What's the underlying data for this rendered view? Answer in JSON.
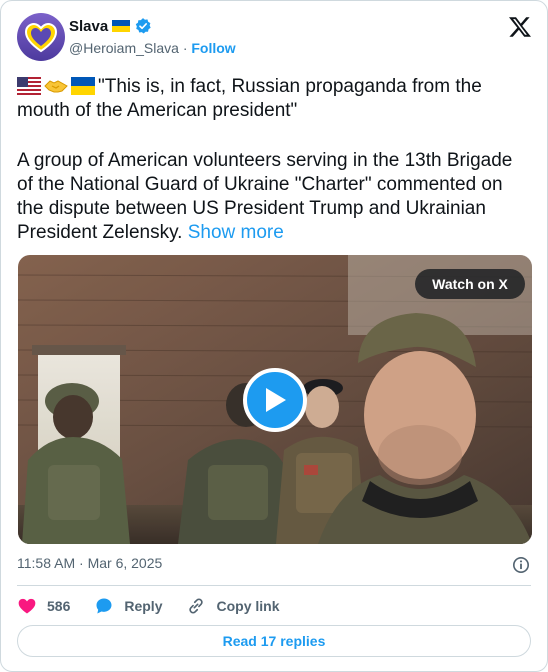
{
  "author": {
    "name": "Slava",
    "handle": "@Heroiam_Slava",
    "separator": "·",
    "follow_label": "Follow"
  },
  "tweet": {
    "line1": "\"This is, in fact, Russian propaganda from the mouth of the American president\"",
    "body": "A group of American volunteers serving in the 13th Brigade of the National Guard of Ukraine \"Charter\" commented on the dispute between US President Trump and Ukrainian President Zelensky.",
    "show_more": "Show more",
    "emojis": [
      "us-flag",
      "handshake",
      "ukraine-flag"
    ]
  },
  "video": {
    "watch_label": "Watch on X"
  },
  "meta": {
    "time": "11:58 AM",
    "separator": "·",
    "date": "Mar 6, 2025"
  },
  "actions": {
    "likes": "586",
    "reply_label": "Reply",
    "copy_label": "Copy link"
  },
  "footer": {
    "replies_label": "Read 17 replies"
  },
  "colors": {
    "accent": "#1d9bf0",
    "like": "#f91880",
    "text": "#0f1419",
    "muted": "#536471",
    "border": "#cfd9de"
  }
}
